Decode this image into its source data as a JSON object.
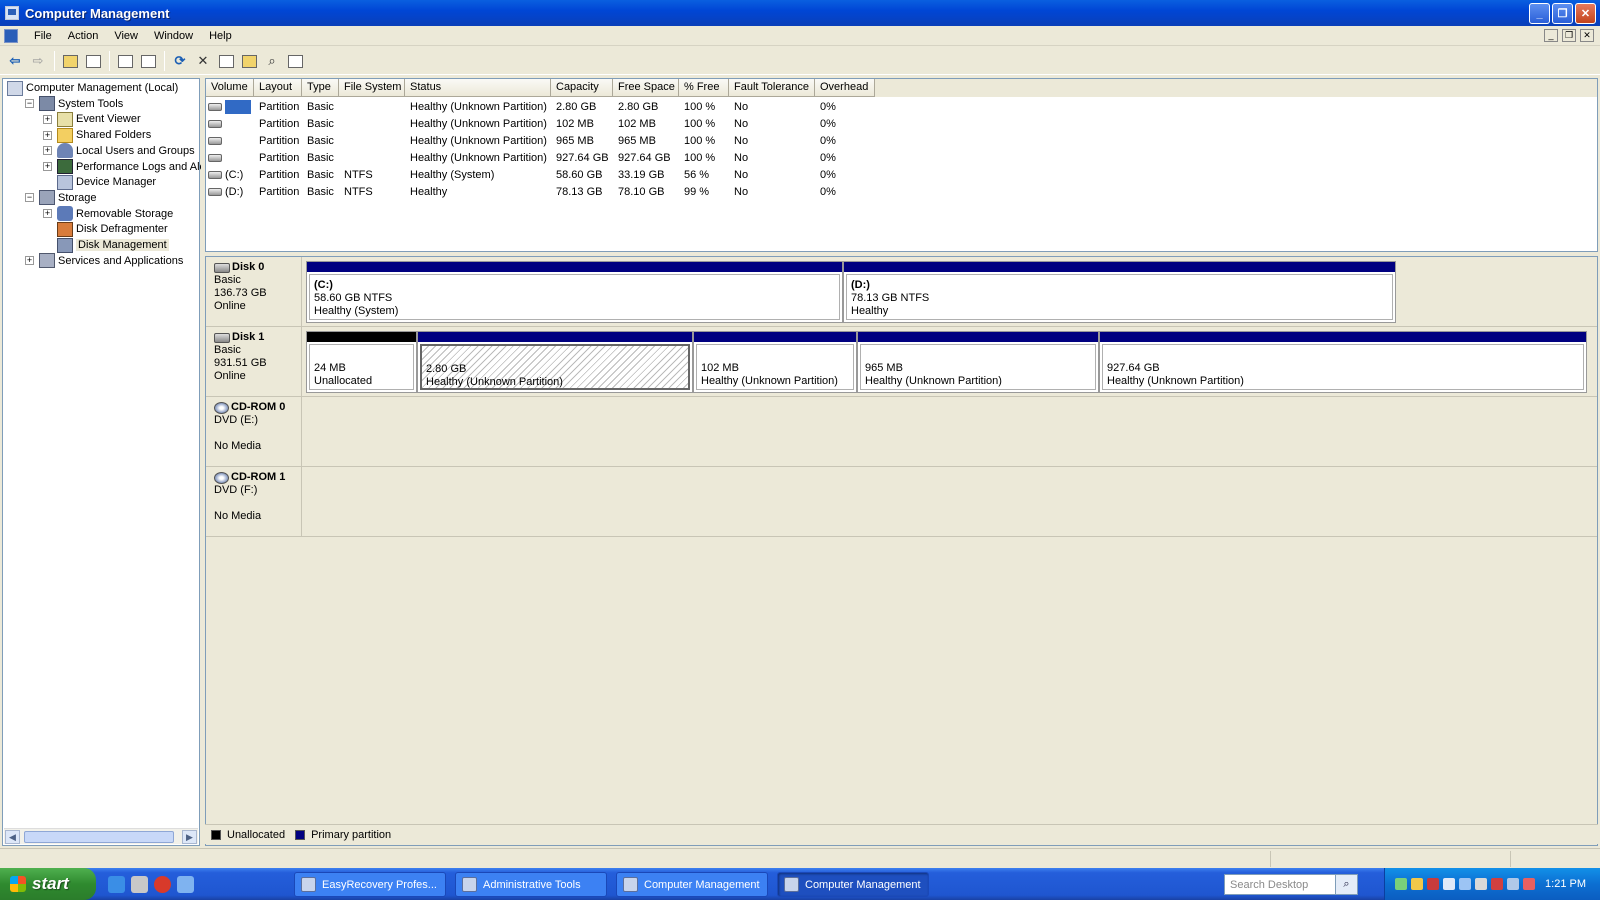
{
  "window": {
    "title": "Computer Management",
    "minimize_glyph": "_",
    "maximize_glyph": "❐",
    "close_glyph": "✕"
  },
  "menu": [
    "File",
    "Action",
    "View",
    "Window",
    "Help"
  ],
  "tree": [
    {
      "label": "Computer Management (Local)",
      "level": 0,
      "expander": "",
      "icon": "computer"
    },
    {
      "label": "System Tools",
      "level": 1,
      "expander": "−",
      "icon": "tools"
    },
    {
      "label": "Event Viewer",
      "level": 2,
      "expander": "+",
      "icon": "event"
    },
    {
      "label": "Shared Folders",
      "level": 2,
      "expander": "+",
      "icon": "folder"
    },
    {
      "label": "Local Users and Groups",
      "level": 2,
      "expander": "+",
      "icon": "users"
    },
    {
      "label": "Performance Logs and Alerts",
      "level": 2,
      "expander": "+",
      "icon": "perf"
    },
    {
      "label": "Device Manager",
      "level": 2,
      "expander": "",
      "icon": "device"
    },
    {
      "label": "Storage",
      "level": 1,
      "expander": "−",
      "icon": "storage"
    },
    {
      "label": "Removable Storage",
      "level": 2,
      "expander": "+",
      "icon": "removable"
    },
    {
      "label": "Disk Defragmenter",
      "level": 2,
      "expander": "",
      "icon": "defrag"
    },
    {
      "label": "Disk Management",
      "level": 2,
      "expander": "",
      "icon": "diskmgmt",
      "selected": true
    },
    {
      "label": "Services and Applications",
      "level": 1,
      "expander": "+",
      "icon": "services"
    }
  ],
  "volume_list": {
    "columns": [
      "Volume",
      "Layout",
      "Type",
      "File System",
      "Status",
      "Capacity",
      "Free Space",
      "% Free",
      "Fault Tolerance",
      "Overhead"
    ],
    "rows": [
      [
        "",
        "Partition",
        "Basic",
        "",
        "Healthy (Unknown Partition)",
        "2.80 GB",
        "2.80 GB",
        "100 %",
        "No",
        "0%"
      ],
      [
        "",
        "Partition",
        "Basic",
        "",
        "Healthy (Unknown Partition)",
        "102 MB",
        "102 MB",
        "100 %",
        "No",
        "0%"
      ],
      [
        "",
        "Partition",
        "Basic",
        "",
        "Healthy (Unknown Partition)",
        "965 MB",
        "965 MB",
        "100 %",
        "No",
        "0%"
      ],
      [
        "",
        "Partition",
        "Basic",
        "",
        "Healthy (Unknown Partition)",
        "927.64 GB",
        "927.64 GB",
        "100 %",
        "No",
        "0%"
      ],
      [
        "(C:)",
        "Partition",
        "Basic",
        "NTFS",
        "Healthy (System)",
        "58.60 GB",
        "33.19 GB",
        "56 %",
        "No",
        "0%"
      ],
      [
        "(D:)",
        "Partition",
        "Basic",
        "NTFS",
        "Healthy",
        "78.13 GB",
        "78.10 GB",
        "99 %",
        "No",
        "0%"
      ]
    ]
  },
  "disks": [
    {
      "name": "Disk 0",
      "type": "Basic",
      "size": "136.73 GB",
      "state": "Online"
    },
    {
      "name": "Disk 1",
      "type": "Basic",
      "size": "931.51 GB",
      "state": "Online"
    },
    {
      "name": "CD-ROM 0",
      "type": "DVD (E:)",
      "state": "No Media"
    },
    {
      "name": "CD-ROM 1",
      "type": "DVD (F:)",
      "state": "No Media"
    }
  ],
  "partitions": {
    "d0_c": {
      "title": "(C:)",
      "size": "58.60 GB NTFS",
      "status": "Healthy (System)"
    },
    "d0_d": {
      "title": "(D:)",
      "size": "78.13 GB NTFS",
      "status": "Healthy"
    },
    "d1_unalloc": {
      "size": "24 MB",
      "status": "Unallocated"
    },
    "d1_p1": {
      "size": "2.80 GB",
      "status": "Healthy (Unknown Partition)"
    },
    "d1_p2": {
      "size": "102 MB",
      "status": "Healthy (Unknown Partition)"
    },
    "d1_p3": {
      "size": "965 MB",
      "status": "Healthy (Unknown Partition)"
    },
    "d1_p4": {
      "size": "927.64 GB",
      "status": "Healthy (Unknown Partition)"
    }
  },
  "legend": {
    "unallocated": "Unallocated",
    "primary": "Primary partition"
  },
  "colors": {
    "primary_partition": "#000080",
    "unallocated": "#000000",
    "title_bar": "#0046d5",
    "selection": "#316ac5"
  },
  "taskbar": {
    "start_label": "start",
    "tasks": [
      {
        "label": "EasyRecovery Profes..."
      },
      {
        "label": "Administrative Tools"
      },
      {
        "label": "Computer Management"
      },
      {
        "label": "Computer Management"
      }
    ],
    "search_placeholder": "Search Desktop",
    "clock": "1:21 PM"
  }
}
